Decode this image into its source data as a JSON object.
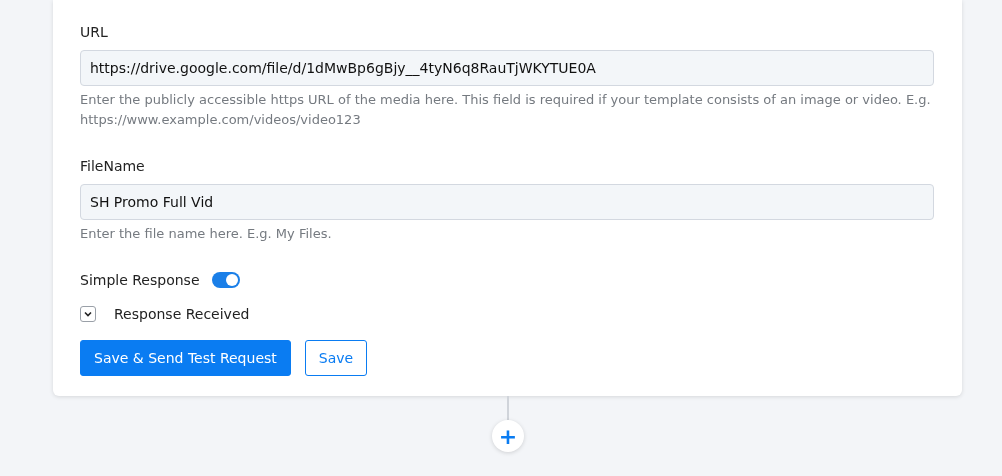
{
  "fields": [
    {
      "label": "URL",
      "value": "https://drive.google.com/file/d/1dMwBp6gBjy__4tyN6q8RauTjWKYTUE0A",
      "help": "Enter the publicly accessible https URL of the media here. This field is required if your template consists of an image or video. E.g. https://www.example.com/videos/video123"
    },
    {
      "label": "FileName",
      "value": "SH Promo Full Vid",
      "help": "Enter the file name here. E.g. My Files."
    }
  ],
  "simple_response": {
    "label": "Simple Response",
    "on": true
  },
  "response_received": {
    "label": "Response Received",
    "expanded": false
  },
  "buttons": [
    {
      "label": "Save & Send Test Request",
      "kind": "primary"
    },
    {
      "label": "Save",
      "kind": "outline"
    }
  ],
  "add_step": {
    "label": "+"
  }
}
